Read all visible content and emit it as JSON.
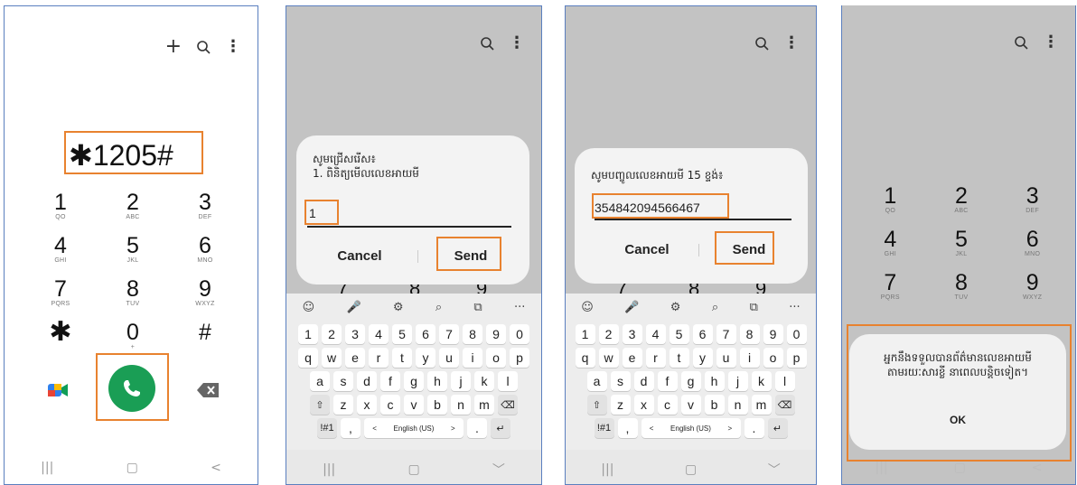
{
  "screen1": {
    "dialed": "✱1205#",
    "keys": [
      {
        "d": "1",
        "l": "QO"
      },
      {
        "d": "2",
        "l": "ABC"
      },
      {
        "d": "3",
        "l": "DEF"
      },
      {
        "d": "4",
        "l": "GHI"
      },
      {
        "d": "5",
        "l": "JKL"
      },
      {
        "d": "6",
        "l": "MNO"
      },
      {
        "d": "7",
        "l": "PQRS"
      },
      {
        "d": "8",
        "l": "TUV"
      },
      {
        "d": "9",
        "l": "WXYZ"
      },
      {
        "d": "✱",
        "l": ""
      },
      {
        "d": "0",
        "l": "+"
      },
      {
        "d": "#",
        "l": ""
      }
    ],
    "toolbar": {
      "add": "+",
      "more": "⋮"
    },
    "nav": {
      "recents": "|||",
      "home": "▢",
      "back": "<"
    }
  },
  "screen2": {
    "title_line1": "សូមជ្រើសរើស៖",
    "title_line2": "1. ពិនិត្យមើលលេខអាយមី",
    "input_value": "1",
    "cancel": "Cancel",
    "send": "Send"
  },
  "screen3": {
    "title": "សូមបញ្ចូលលេខអាយមី 15 ខ្ទង់៖",
    "input_value": "354842094566467",
    "cancel": "Cancel",
    "send": "Send"
  },
  "screen4": {
    "message_line1": "អ្នកនឹងទទួលបានព័ត៌មានលេខអាយមី",
    "message_line2": "តាមរយៈសារខ្លី នាពេលបន្តិចទៀត។",
    "ok": "OK",
    "keys": [
      {
        "d": "1",
        "l": "QO"
      },
      {
        "d": "2",
        "l": "ABC"
      },
      {
        "d": "3",
        "l": "DEF"
      },
      {
        "d": "4",
        "l": "GHI"
      },
      {
        "d": "5",
        "l": "JKL"
      },
      {
        "d": "6",
        "l": "MNO"
      },
      {
        "d": "7",
        "l": "PQRS"
      },
      {
        "d": "8",
        "l": "TUV"
      },
      {
        "d": "9",
        "l": "WXYZ"
      }
    ]
  },
  "keyboard": {
    "numbers": [
      "1",
      "2",
      "3",
      "4",
      "5",
      "6",
      "7",
      "8",
      "9",
      "0"
    ],
    "row1": [
      "q",
      "w",
      "e",
      "r",
      "t",
      "y",
      "u",
      "i",
      "o",
      "p"
    ],
    "row2": [
      "a",
      "s",
      "d",
      "f",
      "g",
      "h",
      "j",
      "k",
      "l"
    ],
    "row3": [
      "z",
      "x",
      "c",
      "v",
      "b",
      "n",
      "m"
    ],
    "symbols": "!#1",
    "comma": ",",
    "period": ".",
    "language": "English (US)",
    "tools": [
      "☺",
      "🎤",
      "⚙",
      "⌕",
      "⧉",
      "···"
    ]
  },
  "colors": {
    "highlight": "#e8822f",
    "call_button": "#1a9e55",
    "border": "#5a7fbf"
  }
}
